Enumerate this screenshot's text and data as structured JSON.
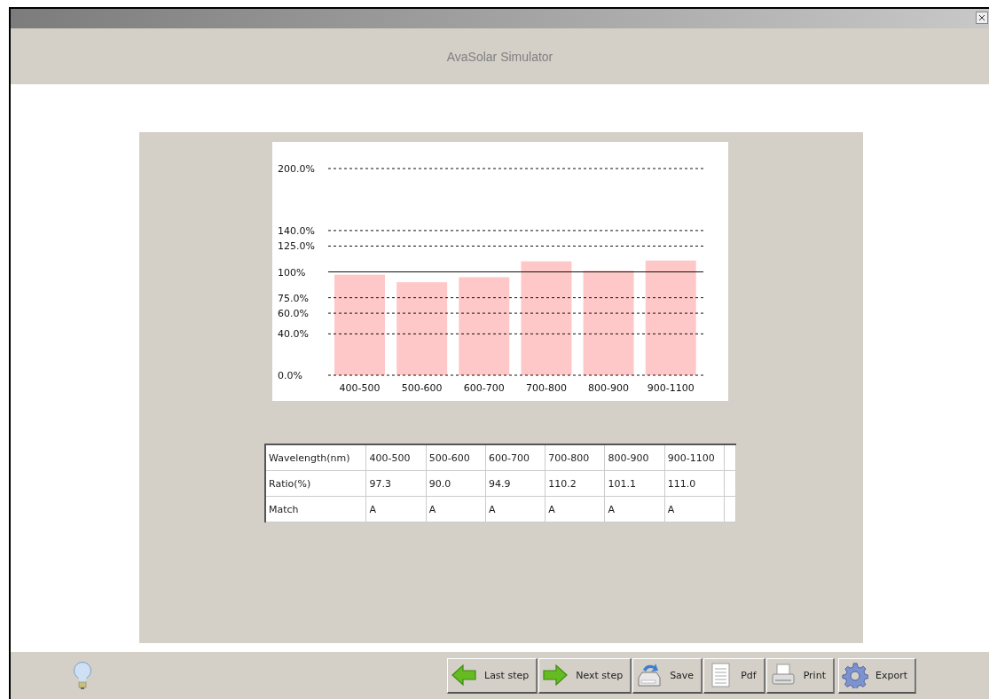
{
  "window": {
    "title": "AvaSolar Simulator"
  },
  "chart": {
    "chart_data": {
      "type": "bar",
      "categories": [
        "400-500",
        "500-600",
        "600-700",
        "700-800",
        "800-900",
        "900-1100"
      ],
      "series": [
        {
          "color": "#ffc8c8",
          "values": [
            97.3,
            90.0,
            94.9,
            110.2,
            101.1,
            111.0
          ]
        }
      ],
      "grid": true,
      "ylim": [
        0,
        200
      ],
      "yticks": [
        {
          "value": 0,
          "label": "0.0%"
        },
        {
          "value": 40,
          "label": "40.0%"
        },
        {
          "value": 60,
          "label": "60.0%"
        },
        {
          "value": 75,
          "label": "75.0%"
        },
        {
          "value": 100,
          "label": "100%"
        },
        {
          "value": 125,
          "label": "125.0%"
        },
        {
          "value": 140,
          "label": "140.0%"
        },
        {
          "value": 200,
          "label": "200.0%"
        }
      ],
      "ref_lines": [
        {
          "axis": "y",
          "value": 100
        }
      ]
    }
  },
  "table": {
    "columns": [
      "Wavelength(nm)",
      "400-500",
      "500-600",
      "600-700",
      "700-800",
      "800-900",
      "900-1100"
    ],
    "rows": [
      [
        "Ratio(%)",
        "97.3",
        "90.0",
        "94.9",
        "110.2",
        "101.1",
        "111.0"
      ],
      [
        "Match",
        "A",
        "A",
        "A",
        "A",
        "A",
        "A"
      ]
    ]
  },
  "toolbar": [
    {
      "label": "Last step"
    },
    {
      "label": "Next step"
    },
    {
      "label": "Save"
    },
    {
      "label": "Pdf"
    },
    {
      "label": "Print"
    },
    {
      "label": "Export"
    }
  ]
}
